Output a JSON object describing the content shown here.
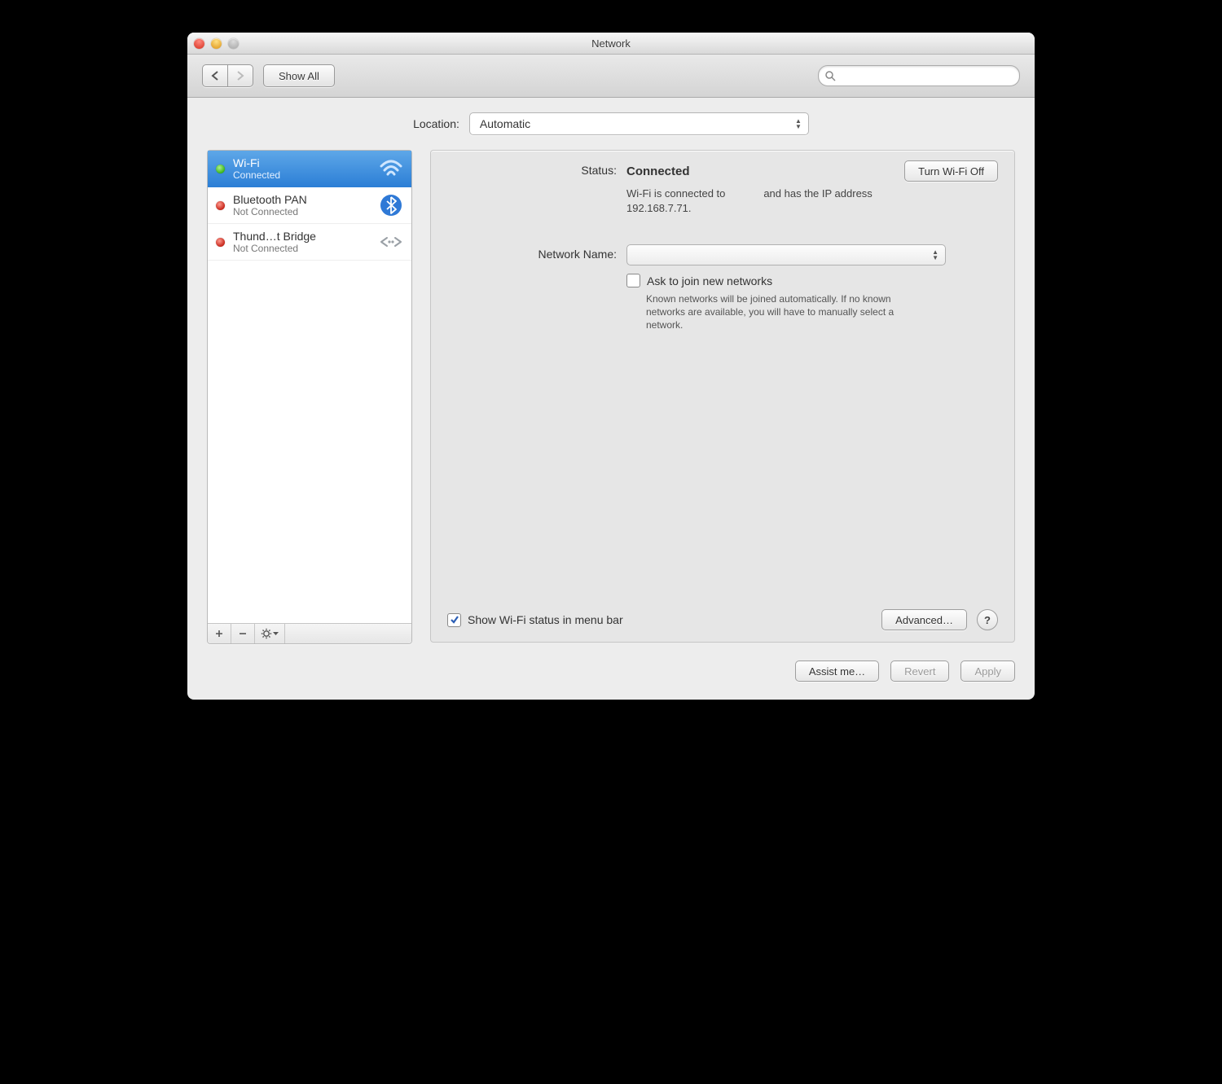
{
  "window": {
    "title": "Network"
  },
  "toolbar": {
    "show_all": "Show All"
  },
  "search": {
    "placeholder": ""
  },
  "location": {
    "label": "Location:",
    "value": "Automatic"
  },
  "services": [
    {
      "name": "Wi-Fi",
      "status": "Connected",
      "status_dot": "green",
      "icon": "wifi",
      "selected": true
    },
    {
      "name": "Bluetooth PAN",
      "status": "Not Connected",
      "status_dot": "red",
      "icon": "bluetooth",
      "selected": false
    },
    {
      "name": "Thund…t Bridge",
      "status": "Not Connected",
      "status_dot": "red",
      "icon": "thunderbolt-bridge",
      "selected": false
    }
  ],
  "detail": {
    "status_label": "Status:",
    "status_value": "Connected",
    "toggle_button": "Turn Wi-Fi Off",
    "status_desc": "Wi-Fi is connected to             and has the IP address 192.168.7.71.",
    "network_name_label": "Network Name:",
    "network_name_value": "",
    "ask_join_label": "Ask to join new networks",
    "ask_join_checked": false,
    "ask_join_desc": "Known networks will be joined automatically. If no known networks are available, you will have to manually select a network.",
    "show_menubar_label": "Show Wi-Fi status in menu bar",
    "show_menubar_checked": true,
    "advanced_button": "Advanced…"
  },
  "footer": {
    "assist": "Assist me…",
    "revert": "Revert",
    "apply": "Apply"
  }
}
